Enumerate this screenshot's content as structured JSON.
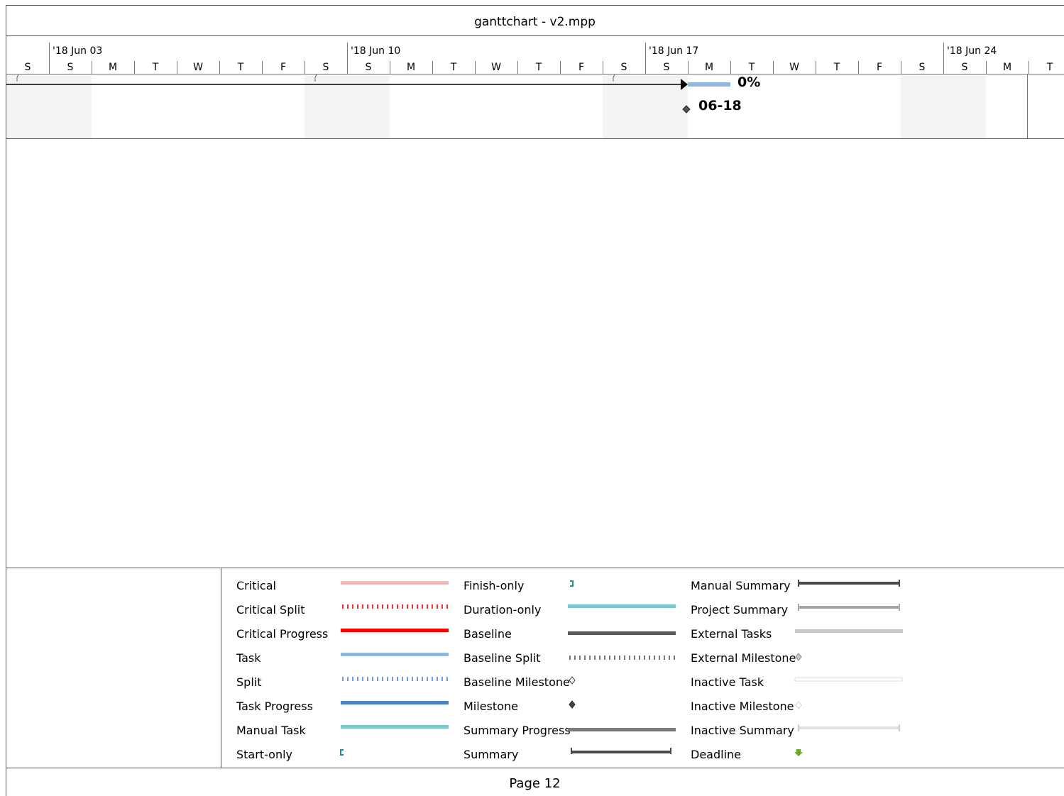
{
  "document": {
    "title": "ganttchart - v2.mpp",
    "page_label": "Page 12"
  },
  "timescale": {
    "weeks": [
      "'18 Jun 03",
      "'18 Jun 10",
      "'18 Jun 17",
      "'18 Jun 24"
    ],
    "days": [
      "S",
      "S",
      "M",
      "T",
      "W",
      "T",
      "F",
      "S",
      "S",
      "M",
      "T",
      "W",
      "T",
      "F",
      "S",
      "S",
      "M",
      "T",
      "W",
      "T",
      "F",
      "S",
      "S",
      "M",
      "T"
    ]
  },
  "bars": {
    "progress_label": "0%",
    "milestone_label": "06-18"
  },
  "legend": {
    "col1": [
      "Critical",
      "Critical Split",
      "Critical Progress",
      "Task",
      "Split",
      "Task Progress",
      "Manual Task",
      "Start-only"
    ],
    "col2": [
      "Finish-only",
      "Duration-only",
      "Baseline",
      "Baseline Split",
      "Baseline Milestone",
      "Milestone",
      "Summary Progress",
      "Summary"
    ],
    "col3": [
      "Manual Summary",
      "Project Summary",
      "External Tasks",
      "External Milestone",
      "Inactive Task",
      "Inactive Milestone",
      "Inactive Summary",
      "Deadline"
    ]
  },
  "colors": {
    "critical": "#f9b7b7",
    "critical_split": "#ff3030",
    "critical_progress": "#ff0000",
    "task": "#8fb9e3",
    "task_progress": "#4a7ec6",
    "manual": "#79c7cf",
    "baseline": "#5a5a5a",
    "summary_progress": "#7a7a7a",
    "summary": "#4a4a4a",
    "project_summary": "#a6a6a6",
    "external": "#c8c8c8",
    "inactive": "#e0e0e0",
    "deadline": "#6aaa1e",
    "start_finish": "#1f8f9a",
    "weekend_shade": "#f4f4f4"
  }
}
